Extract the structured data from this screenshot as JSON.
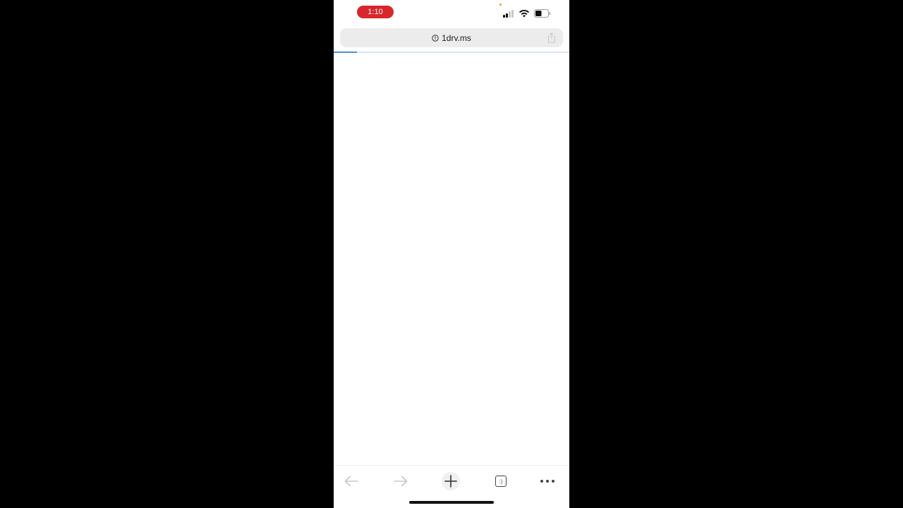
{
  "status_bar": {
    "time": "1:10",
    "time_pill_color": "#d9262c",
    "signal_bars_active": 2,
    "signal_bars_total": 4,
    "battery_level": 0.5
  },
  "browser": {
    "url": "1drv.ms",
    "page_loading_progress": 0.1,
    "accent_color": "#4a90c9"
  },
  "toolbar": {
    "back_icon": "back-arrow-icon",
    "forward_icon": "forward-arrow-icon",
    "new_tab_icon": "plus-icon",
    "tabs_icon": "tabs-icon",
    "tab_count": ":)",
    "menu_icon": "more-dots-icon"
  }
}
